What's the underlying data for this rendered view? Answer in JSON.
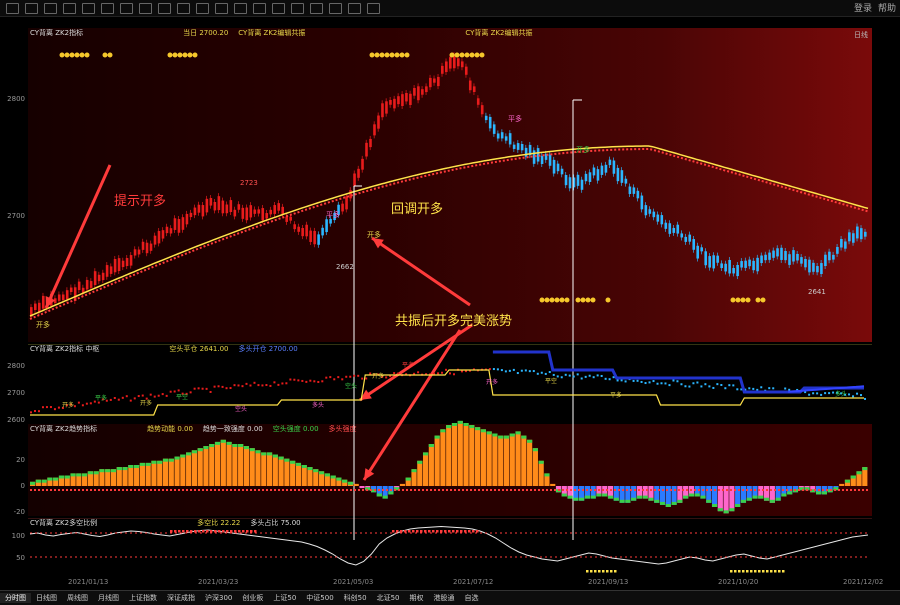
{
  "window": {
    "title_right_1": "登录",
    "title_right_2": "帮助"
  },
  "main_panel": {
    "title_left": "CY背离 ZK2指标",
    "title_mid": "当日 2700.20",
    "title_mid2": "CY背离 ZK2编辑共振",
    "title_right": "CY背离 ZK2编辑共振",
    "corner_label": "日线",
    "y_ticks": [
      "2800",
      "2700"
    ],
    "price_labels": {
      "high1": "2723",
      "low1": "2662",
      "low2": "2641"
    },
    "annotations": {
      "hint_open_long": "提示开多",
      "pullback_open_long": "回调开多",
      "resonance_trend": "共振后开多完美涨势"
    },
    "marker_labels": {
      "start": "开多",
      "pullback": "开多",
      "flat": "平多",
      "flat2": "平多",
      "mid": "开多"
    }
  },
  "sub1": {
    "title": "CY背离 ZK2指标 中枢",
    "v1": "空头平仓 2641.00",
    "v2": "多头开仓 2700.00",
    "y_ticks": [
      "2800",
      "2700",
      "2600"
    ],
    "labels": [
      "开多",
      "平多",
      "开多",
      "平空",
      "空头",
      "多头",
      "空头",
      "开多",
      "平多",
      "开多",
      "平空",
      "平多",
      "多头"
    ]
  },
  "sub2": {
    "title": "CY背离 ZK2趋势指标",
    "v1": "趋势动能 0.00",
    "v2": "趋势一致强度 0.00",
    "v3": "空头强度 0.00",
    "v4": "多头强度",
    "y_ticks": [
      "20",
      "0",
      "-20"
    ],
    "bars": [
      2,
      3,
      3,
      4,
      4,
      5,
      5,
      6,
      6,
      6,
      7,
      7,
      8,
      8,
      8,
      9,
      9,
      10,
      10,
      11,
      11,
      12,
      12,
      13,
      13,
      14,
      15,
      16,
      17,
      18,
      19,
      20,
      21,
      22,
      21,
      20,
      20,
      19,
      18,
      17,
      16,
      16,
      15,
      14,
      13,
      12,
      11,
      10,
      9,
      8,
      7,
      6,
      5,
      4,
      3,
      2,
      1,
      -1,
      -2,
      -3,
      -5,
      -6,
      -4,
      -2,
      1,
      4,
      8,
      12,
      16,
      20,
      24,
      27,
      29,
      30,
      31,
      30,
      29,
      28,
      27,
      26,
      25,
      24,
      24,
      25,
      26,
      24,
      22,
      18,
      12,
      6,
      1,
      -3,
      -5,
      -6,
      -7,
      -7,
      -6,
      -6,
      -5,
      -5,
      -6,
      -7,
      -8,
      -8,
      -7,
      -6,
      -6,
      -7,
      -8,
      -9,
      -10,
      -9,
      -8,
      -6,
      -5,
      -5,
      -6,
      -8,
      -10,
      -12,
      -13,
      -12,
      -10,
      -8,
      -7,
      -6,
      -6,
      -7,
      -8,
      -7,
      -5,
      -4,
      -3,
      -2,
      -2,
      -3,
      -4,
      -4,
      -3,
      -2,
      1,
      3,
      5,
      7,
      9
    ]
  },
  "sub3": {
    "title": "CY背离 ZK2多空比例",
    "v1": "多空比 22.22",
    "v2": "多头占比 75.00",
    "y_ticks": [
      "100",
      "50"
    ],
    "line": [
      80,
      82,
      78,
      76,
      79,
      81,
      83,
      80,
      77,
      75,
      78,
      82,
      84,
      86,
      85,
      83,
      80,
      78,
      76,
      79,
      82,
      85,
      87,
      88,
      86,
      84,
      82,
      80,
      78,
      76,
      74,
      72,
      70,
      68,
      66,
      64,
      60,
      55,
      48,
      40,
      30,
      22,
      18,
      25,
      40,
      60,
      72,
      80,
      86,
      90,
      92,
      93,
      94,
      95,
      94,
      93,
      92,
      90,
      86,
      80,
      72,
      62,
      52,
      44,
      38,
      34,
      30,
      28,
      26,
      30,
      34,
      38,
      42,
      40,
      36,
      32,
      30,
      28,
      26,
      24,
      22,
      20,
      22,
      26,
      30,
      34,
      32,
      28,
      26,
      30,
      34,
      38,
      40,
      36,
      32,
      30,
      34,
      38,
      42,
      46,
      50,
      54,
      58,
      62,
      66,
      70,
      74,
      76,
      78
    ]
  },
  "xaxis": [
    "2021/01/13",
    "2021/03/23",
    "2021/05/03",
    "2021/07/12",
    "2021/09/13",
    "2021/10/20",
    "2021/12/02"
  ],
  "tabs": [
    "分时图",
    "日线图",
    "周线图",
    "月线图",
    "上证指数",
    "深证成指",
    "沪深300",
    "创业板",
    "上证50",
    "中证500",
    "科创50",
    "北证50",
    "期权",
    "港股通",
    "自选"
  ]
}
